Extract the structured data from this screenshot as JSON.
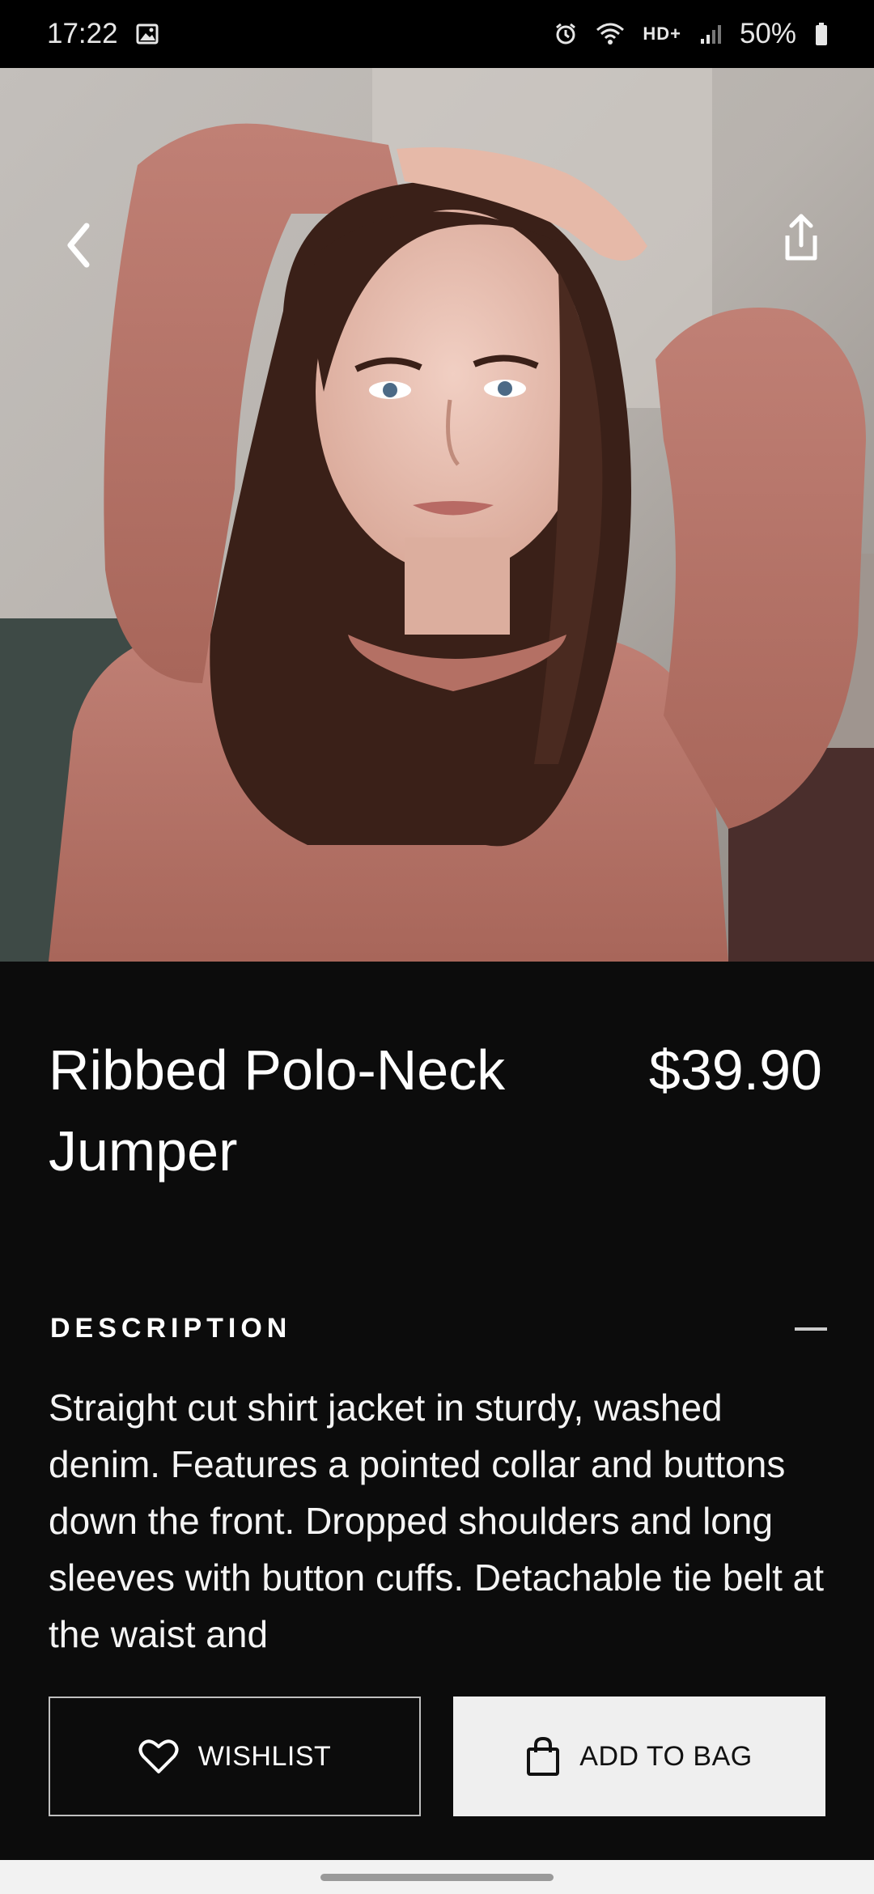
{
  "status_bar": {
    "time": "17:22",
    "network": "HD+",
    "battery": "50%",
    "icons": [
      "image-icon",
      "alarm-icon",
      "wifi-icon",
      "signal-icon",
      "battery-icon"
    ]
  },
  "hero": {
    "image_name": "product-photo",
    "back_icon": "chevron-left-icon",
    "share_icon": "share-icon"
  },
  "product": {
    "title": "Ribbed Polo-Neck Jumper",
    "price": "$39.90"
  },
  "description": {
    "label": "DESCRIPTION",
    "toggle_icon": "minus-icon",
    "text": "Straight cut shirt jacket in sturdy, washed denim. Features a pointed collar and buttons down the front. Dropped shoulders and long sleeves with button cuffs. Detachable tie belt at the waist and"
  },
  "actions": {
    "wishlist_label": "WISHLIST",
    "wishlist_icon": "heart-icon",
    "bag_label": "ADD TO BAG",
    "bag_icon": "shopping-bag-icon"
  },
  "colors": {
    "background": "#0c0c0c",
    "text": "#ffffff",
    "bag_button": "#efefef",
    "sweater": "#b87468"
  }
}
